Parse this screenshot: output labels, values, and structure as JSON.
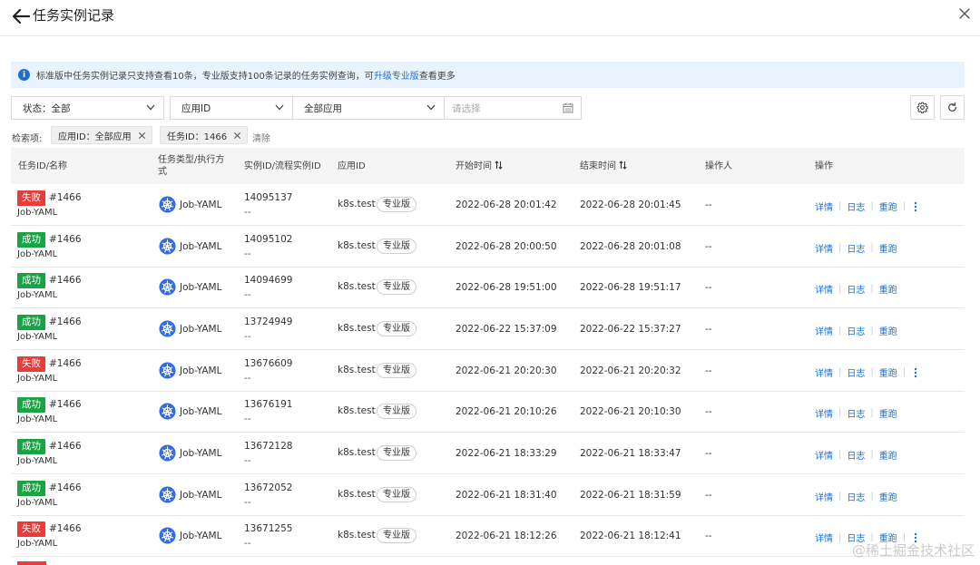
{
  "header": {
    "title": "任务实例记录"
  },
  "notice": {
    "text_before": "标准版中任务实例记录只支持查看10条，专业版支持100条记录的任务实例查询，可",
    "link": "升级专业版",
    "text_after": "查看更多"
  },
  "filters": {
    "status": "状态：全部",
    "app_id_select": "应用ID",
    "app_scope": "全部应用",
    "date_placeholder": "请选择"
  },
  "search_terms": {
    "label": "检索项:",
    "tags": [
      "应用ID：全部应用",
      "任务ID：1466"
    ],
    "clear": "清除"
  },
  "table": {
    "headers": {
      "task": "任务ID/名称",
      "type_line1": "任务类型/执行方",
      "type_line2": "式",
      "instance": "实例ID/流程实例ID",
      "app": "应用ID",
      "start": "开始时间",
      "end": "结束时间",
      "operator": "操作人",
      "actions": "操作"
    },
    "rows": [
      {
        "status": "失败",
        "status_kind": "fail",
        "task_num": "#1466",
        "task_name": "Job-YAML",
        "type": "Job-YAML",
        "instance_id": "14095137",
        "flow_id": "--",
        "app_id": "k8s.test",
        "edition": "专业版",
        "start": "2022-06-28 20:01:42",
        "end": "2022-06-28 20:01:45",
        "operator": "--"
      },
      {
        "status": "成功",
        "status_kind": "ok",
        "task_num": "#1466",
        "task_name": "Job-YAML",
        "type": "Job-YAML",
        "instance_id": "14095102",
        "flow_id": "--",
        "app_id": "k8s.test",
        "edition": "专业版",
        "start": "2022-06-28 20:00:50",
        "end": "2022-06-28 20:01:08",
        "operator": "--"
      },
      {
        "status": "成功",
        "status_kind": "ok",
        "task_num": "#1466",
        "task_name": "Job-YAML",
        "type": "Job-YAML",
        "instance_id": "14094699",
        "flow_id": "--",
        "app_id": "k8s.test",
        "edition": "专业版",
        "start": "2022-06-28 19:51:00",
        "end": "2022-06-28 19:51:17",
        "operator": "--"
      },
      {
        "status": "成功",
        "status_kind": "ok",
        "task_num": "#1466",
        "task_name": "Job-YAML",
        "type": "Job-YAML",
        "instance_id": "13724949",
        "flow_id": "--",
        "app_id": "k8s.test",
        "edition": "专业版",
        "start": "2022-06-22 15:37:09",
        "end": "2022-06-22 15:37:27",
        "operator": "--"
      },
      {
        "status": "失败",
        "status_kind": "fail",
        "task_num": "#1466",
        "task_name": "Job-YAML",
        "type": "Job-YAML",
        "instance_id": "13676609",
        "flow_id": "--",
        "app_id": "k8s.test",
        "edition": "专业版",
        "start": "2022-06-21 20:20:30",
        "end": "2022-06-21 20:20:32",
        "operator": "--"
      },
      {
        "status": "成功",
        "status_kind": "ok",
        "task_num": "#1466",
        "task_name": "Job-YAML",
        "type": "Job-YAML",
        "instance_id": "13676191",
        "flow_id": "--",
        "app_id": "k8s.test",
        "edition": "专业版",
        "start": "2022-06-21 20:10:26",
        "end": "2022-06-21 20:10:30",
        "operator": "--"
      },
      {
        "status": "成功",
        "status_kind": "ok",
        "task_num": "#1466",
        "task_name": "Job-YAML",
        "type": "Job-YAML",
        "instance_id": "13672128",
        "flow_id": "--",
        "app_id": "k8s.test",
        "edition": "专业版",
        "start": "2022-06-21 18:33:29",
        "end": "2022-06-21 18:33:47",
        "operator": "--"
      },
      {
        "status": "成功",
        "status_kind": "ok",
        "task_num": "#1466",
        "task_name": "Job-YAML",
        "type": "Job-YAML",
        "instance_id": "13672052",
        "flow_id": "--",
        "app_id": "k8s.test",
        "edition": "专业版",
        "start": "2022-06-21 18:31:40",
        "end": "2022-06-21 18:31:59",
        "operator": "--"
      },
      {
        "status": "失败",
        "status_kind": "fail",
        "task_num": "#1466",
        "task_name": "Job-YAML",
        "type": "Job-YAML",
        "instance_id": "13671255",
        "flow_id": "--",
        "app_id": "k8s.test",
        "edition": "专业版",
        "start": "2022-06-21 18:12:26",
        "end": "2022-06-21 18:12:41",
        "operator": "--"
      }
    ],
    "actions": {
      "detail": "详情",
      "log": "日志",
      "rerun": "重跑"
    }
  },
  "colors": {
    "fail": "#ea3b3b",
    "success": "#1aa345",
    "link": "#1c6fd1",
    "k8s": "#326ce5"
  },
  "watermark": "@稀土掘金技术社区"
}
